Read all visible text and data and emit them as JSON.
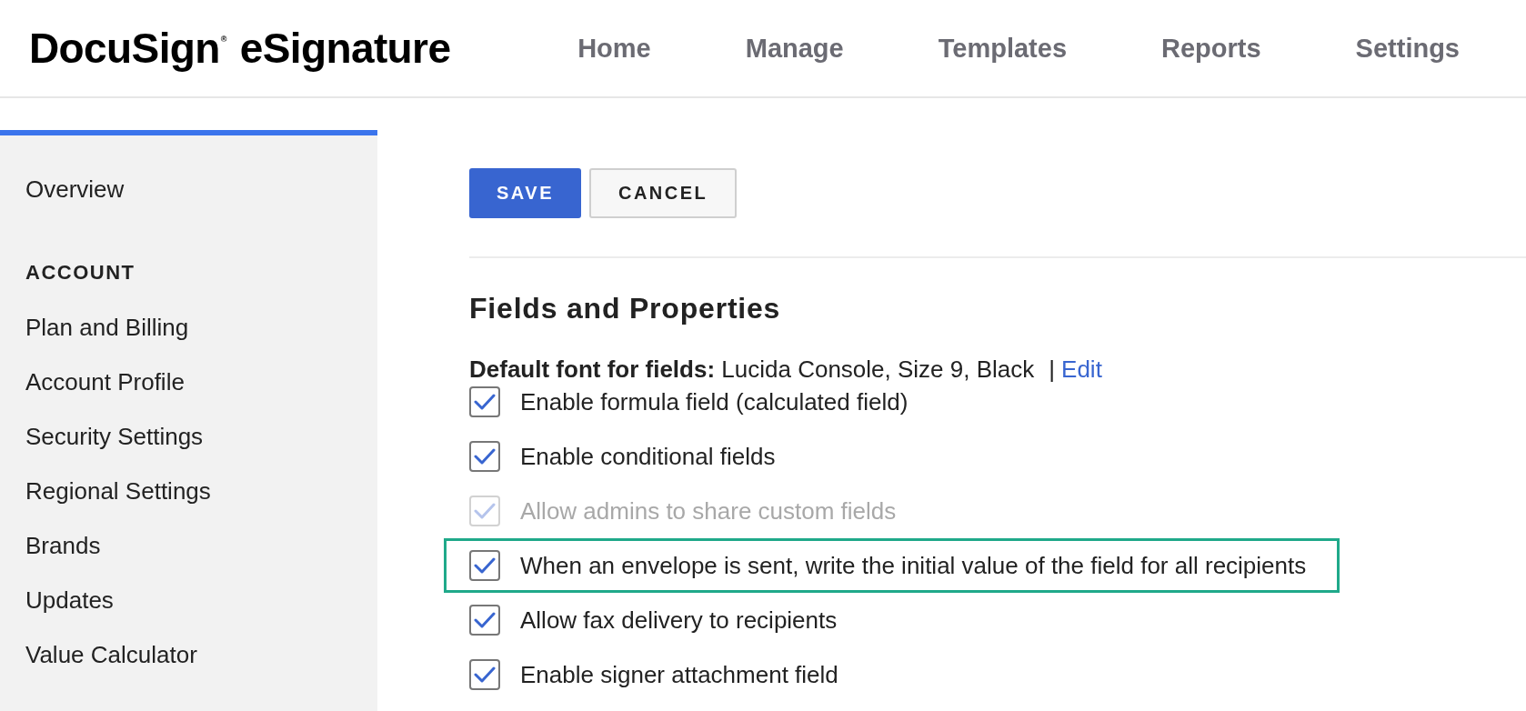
{
  "header": {
    "logo": "DocuSign$^{®}$ eSignature",
    "nav": [
      "Home",
      "Manage",
      "Templates",
      "Reports",
      "Settings"
    ]
  },
  "sidebar": {
    "items": [
      {
        "kind": "link",
        "label": "Overview"
      },
      {
        "kind": "heading",
        "label": "ACCOUNT"
      },
      {
        "kind": "link",
        "label": "Plan and Billing"
      },
      {
        "kind": "link",
        "label": "Account Profile"
      },
      {
        "kind": "link",
        "label": "Security Settings"
      },
      {
        "kind": "link",
        "label": "Regional Settings"
      },
      {
        "kind": "link",
        "label": "Brands"
      },
      {
        "kind": "link",
        "label": "Updates"
      },
      {
        "kind": "link",
        "label": "Value Calculator"
      }
    ]
  },
  "toolbar": {
    "buttons": [
      {
        "kind": "primary",
        "label": "SAVE"
      },
      {
        "kind": "secondary",
        "label": "CANCEL"
      }
    ]
  },
  "section": {
    "title": "Fields and Properties",
    "default_font": {
      "text": "**Default font for fields:** Lucida Console, Size 9, Black",
      "separator": "|",
      "link": "Edit"
    },
    "options": [
      {
        "label": "Enable formula field (calculated field)",
        "checked": true,
        "disabled": false,
        "highlighted": false
      },
      {
        "label": "Enable conditional fields",
        "checked": true,
        "disabled": false,
        "highlighted": false
      },
      {
        "label": "Allow admins to share custom fields",
        "checked": true,
        "disabled": true,
        "highlighted": false
      },
      {
        "label": "When an envelope is sent, write the initial value of the field for all recipients",
        "checked": true,
        "disabled": false,
        "highlighted": true
      },
      {
        "label": "Allow fax delivery to recipients",
        "checked": true,
        "disabled": false,
        "highlighted": false
      },
      {
        "label": "Enable signer attachment field",
        "checked": true,
        "disabled": false,
        "highlighted": false
      }
    ]
  }
}
